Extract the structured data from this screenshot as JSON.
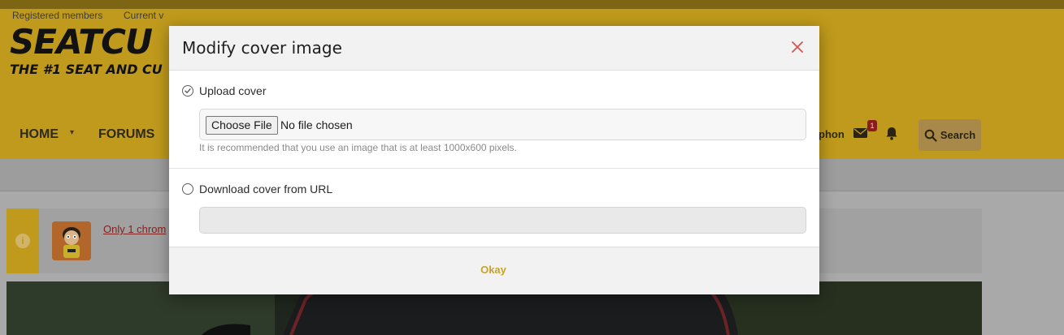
{
  "site": {
    "logo_text": "SEATCU",
    "logo_tagline": "THE #1 SEAT AND CU",
    "nav": {
      "home": "HOME",
      "forums": "FORUMS",
      "user_fragment": "phon",
      "inbox_badge": "1",
      "search_label": "Search"
    },
    "subnav": {
      "registered": "Registered members",
      "current": "Current v"
    },
    "notice": {
      "link_text": "Only 1 chrom"
    }
  },
  "modal": {
    "title": "Modify cover image",
    "options": {
      "upload_label": "Upload cover",
      "url_label": "Download cover from URL"
    },
    "file": {
      "button_label": "Choose File",
      "status": "No file chosen"
    },
    "hint": "It is recommended that you use an image that is at least 1000x600 pixels.",
    "url_value": "",
    "okay_label": "Okay"
  },
  "colors": {
    "brand": "#bf9a1c",
    "accent_button_text": "#c9a227",
    "close_icon": "#d9534f"
  },
  "icons": {
    "close": "close-icon",
    "mail": "mail-icon",
    "bell": "bell-icon",
    "search": "search-icon",
    "info": "info-icon",
    "check": "check-icon"
  }
}
